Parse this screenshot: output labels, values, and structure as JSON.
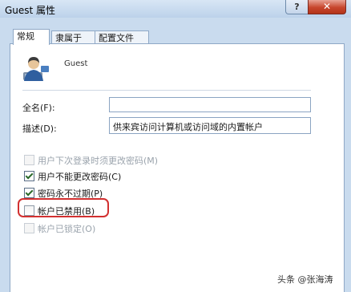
{
  "window": {
    "title": "Guest 属性",
    "help_label": "?",
    "close_label": "✕"
  },
  "tabs": [
    {
      "label": "常规",
      "active": true
    },
    {
      "label": "隶属于",
      "active": false
    },
    {
      "label": "配置文件",
      "active": false
    }
  ],
  "user": {
    "name": "Guest",
    "avatar_icon": "user-icon"
  },
  "fields": {
    "fullname_label": "全名(F):",
    "fullname_value": "",
    "description_label": "描述(D):",
    "description_value": "供来宾访问计算机或访问域的内置帐户"
  },
  "options": [
    {
      "label": "用户下次登录时须更改密码(M)",
      "checked": false,
      "disabled": true
    },
    {
      "label": "用户不能更改密码(C)",
      "checked": true,
      "disabled": false
    },
    {
      "label": "密码永不过期(P)",
      "checked": true,
      "disabled": false
    },
    {
      "label": "帐户已禁用(B)",
      "checked": false,
      "disabled": false
    },
    {
      "label": "帐户已锁定(O)",
      "checked": false,
      "disabled": true
    }
  ],
  "watermark": "头条 @张海涛",
  "colors": {
    "highlight": "#d23030",
    "close_button": "#c7462d"
  }
}
